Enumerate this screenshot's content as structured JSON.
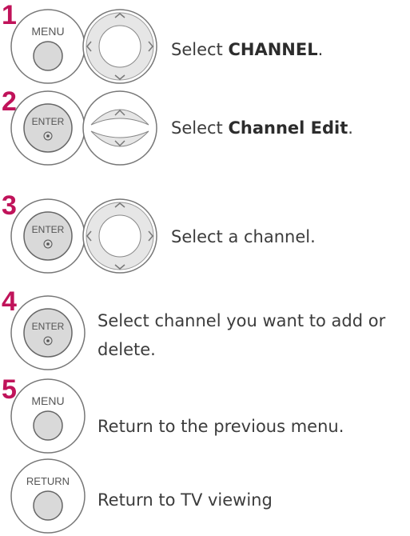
{
  "steps": [
    {
      "number": "1",
      "button": "MENU",
      "nav": "4-way",
      "text": "Select ",
      "bold": "CHANNEL",
      "suffix": "."
    },
    {
      "number": "2",
      "button": "ENTER",
      "nav": "up-down",
      "text": "Select ",
      "bold": "Channel Edit",
      "suffix": "."
    },
    {
      "number": "3",
      "button": "ENTER",
      "nav": "4-way",
      "text": "Select a channel."
    },
    {
      "number": "4",
      "button": "ENTER",
      "text_line1": "Select channel you want to add or",
      "text_line2": "delete."
    },
    {
      "number": "5",
      "button": "MENU",
      "text": "Return to the previous menu."
    },
    {
      "number": "",
      "button": "RETURN",
      "text": "Return to TV viewing"
    }
  ],
  "colors": {
    "step_number": "#c0135a",
    "button_fill": "#d9d9d9",
    "outline": "#777777"
  },
  "icons": {
    "enter_glyph": "dot-in-circle-icon",
    "arrows": "chevron-icon"
  }
}
